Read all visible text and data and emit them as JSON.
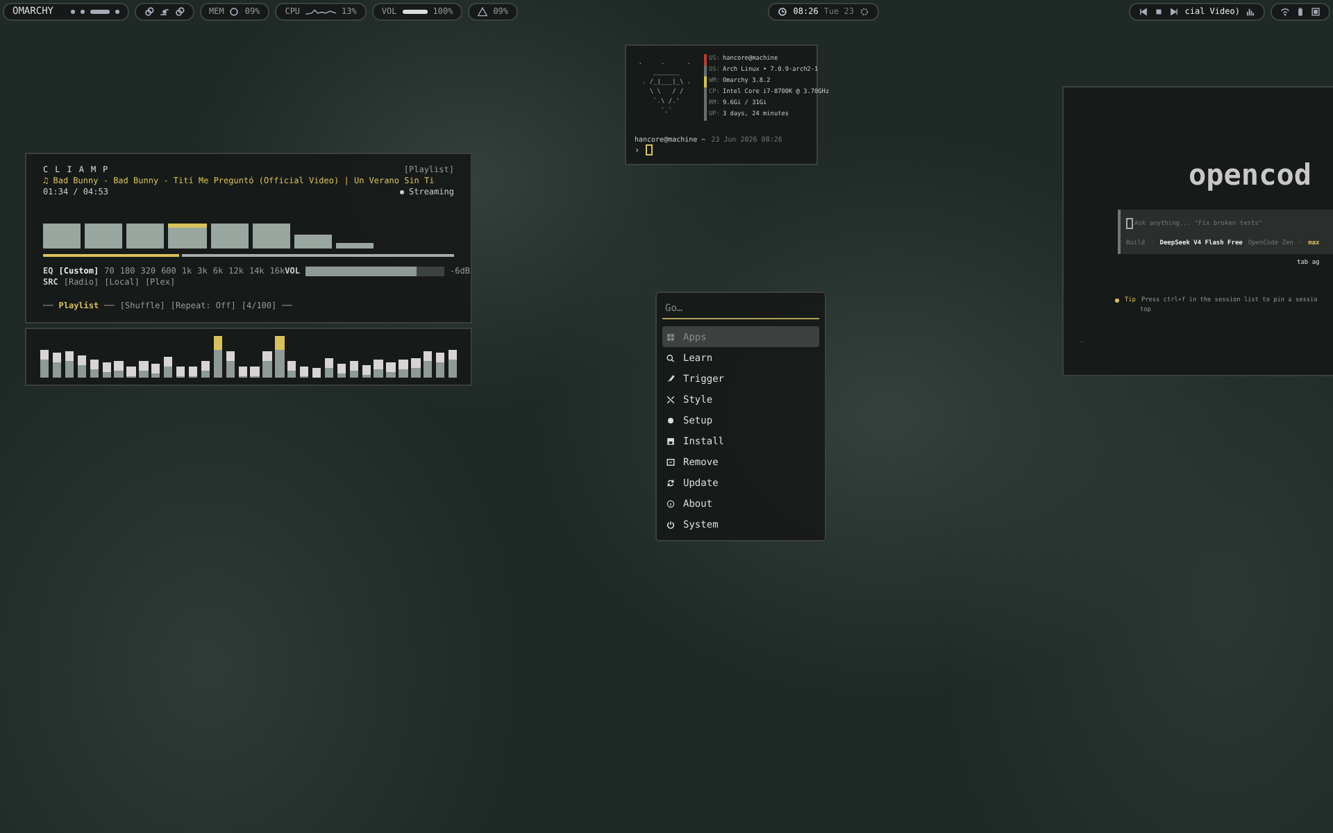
{
  "top_bar": {
    "logo": "OMARCHY",
    "workspaces": [
      {
        "selected": false
      },
      {
        "selected": false
      },
      {
        "selected": true
      },
      {
        "selected": false
      }
    ],
    "mem": {
      "label": "MEM",
      "value": "09%"
    },
    "cpu": {
      "label": "CPU",
      "value": "13%"
    },
    "vol": {
      "label": "VOL",
      "level": 1.0,
      "value": "100%"
    },
    "alert": {
      "value": "09%"
    },
    "clock": {
      "time": "08:26",
      "date": "Tue 23"
    },
    "media": {
      "title": "cial Video)"
    }
  },
  "player": {
    "title": "CLIAMP",
    "playlist_button": "[Playlist]",
    "track": "♫ Bad Bunny - Bad Bunny - Tití Me Preguntó (Official Video) | Un Verano Sin Ti",
    "time": "01:34 / 04:53",
    "status": "Streaming",
    "progress": {
      "level": 0.33
    },
    "eq": {
      "label": "EQ",
      "presets": [
        {
          "label": "[Custom]",
          "selected": true
        }
      ],
      "bands": [
        "70",
        "180",
        "320",
        "600",
        "1k",
        "3k",
        "6k",
        "12k",
        "14k",
        "16k"
      ]
    },
    "src": {
      "label": "SRC",
      "options": [
        {
          "label": "[Radio]",
          "selected": false
        },
        {
          "label": "[Local]",
          "selected": false
        },
        {
          "label": "[Plex]",
          "selected": false
        }
      ]
    },
    "volume": {
      "label": "VOL",
      "level": 0.8,
      "reading": "-6dB"
    },
    "footer": {
      "lead": "──",
      "playlist": "Playlist",
      "sep": "──",
      "items": [
        "[Shuffle]",
        "[Repeat: Off]",
        "[4/100]"
      ],
      "tail": "──"
    }
  },
  "terminal": {
    "art": [
      " .     .      .",
      "     _______",
      "  . /_|___|_\\ .",
      "    \\ \\   / /",
      "     `.\\ /.'",
      "       `.`"
    ],
    "info": [
      {
        "key": "US:",
        "value": "hancore@machine",
        "color": "#c0392b"
      },
      {
        "key": "OS:",
        "value": "Arch Linux • 7.0.9-arch2-1",
        "color": "#6b6f6e"
      },
      {
        "key": "WM:",
        "value": "Omarchy 3.8.2",
        "color": "#d4c24a"
      },
      {
        "key": "CP:",
        "value": "Intel Core i7-8700K @ 3.70GHz",
        "color": "#6b6f6e"
      },
      {
        "key": "RM:",
        "value": "9.6Gi / 31Gi",
        "color": "#6b6f6e"
      },
      {
        "key": "UP:",
        "value": "3 days, 24 minutes",
        "color": "#6b6f6e"
      }
    ],
    "prompt": {
      "user": "hancore@machine ~",
      "date": "23 Jun 2026 08:26",
      "symbol": "›"
    }
  },
  "launcher": {
    "placeholder": "Go…",
    "items": [
      {
        "label": "Apps",
        "selected": true
      },
      {
        "label": "Learn",
        "selected": false
      },
      {
        "label": "Trigger",
        "selected": false
      },
      {
        "label": "Style",
        "selected": false
      },
      {
        "label": "Setup",
        "selected": false
      },
      {
        "label": "Install",
        "selected": false
      },
      {
        "label": "Remove",
        "selected": false
      },
      {
        "label": "Update",
        "selected": false
      },
      {
        "label": "About",
        "selected": false
      },
      {
        "label": "System",
        "selected": false
      }
    ]
  },
  "opencode": {
    "logo": "opencod",
    "placeholder": "Ask anything... \"Fix broken tests\"",
    "mode": "Build",
    "separator": "·",
    "model": "DeepSeek V4 Flash Free",
    "provider": "OpenCode Zen",
    "variant": "max",
    "hint": "tab ag",
    "tip_label": "Tip",
    "tip": "Press ctrl+f in the session list to pin a sessio",
    "tip_cont": "top",
    "cursor": "_"
  }
}
